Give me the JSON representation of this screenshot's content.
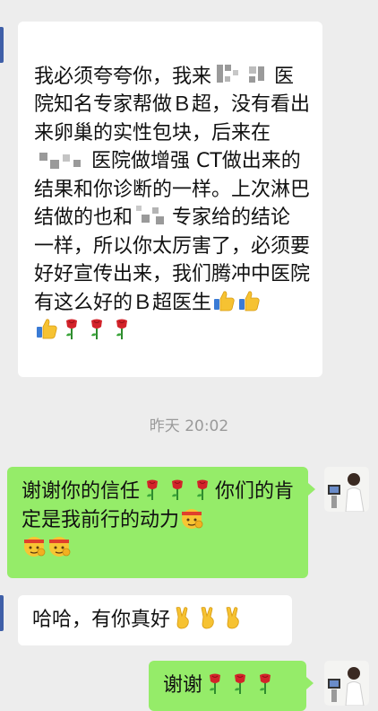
{
  "messages": [
    {
      "direction": "incoming",
      "segments": [
        "我必须夸夸你，我来",
        "医院知名专家帮做Ｂ超，没有看出来卵巢的实性包块，后来在",
        "医院做增强 CT做出来的结果和你诊断的一样。上次淋巴结做的也和",
        "专家给的结论一样，所以你太厉害了，必须要好好宣传出来，我们腾冲中医院有这么好的Ｂ超医生"
      ],
      "emojis": [
        "thumbs-up",
        "thumbs-up",
        "thumbs-up",
        "rose",
        "rose",
        "rose"
      ]
    },
    {
      "direction": "outgoing",
      "segments": [
        "谢谢你的信任",
        "你们的肯定是我前行的动力"
      ],
      "emojis_mid": [
        "rose",
        "rose",
        "rose"
      ],
      "emojis_end": [
        "strong-face",
        "strong-face",
        "strong-face"
      ]
    },
    {
      "direction": "incoming",
      "segments": [
        "哈哈，有你真好"
      ],
      "emojis": [
        "victory-hand",
        "victory-hand",
        "victory-hand"
      ]
    },
    {
      "direction": "outgoing",
      "segments": [
        "谢谢"
      ],
      "emojis": [
        "rose",
        "rose",
        "rose"
      ]
    }
  ],
  "timestamp": "昨天 20:02",
  "colors": {
    "background": "#ededed",
    "incoming_bubble": "#ffffff",
    "outgoing_bubble": "#95ec69",
    "timestamp_text": "#9a9a9a"
  }
}
